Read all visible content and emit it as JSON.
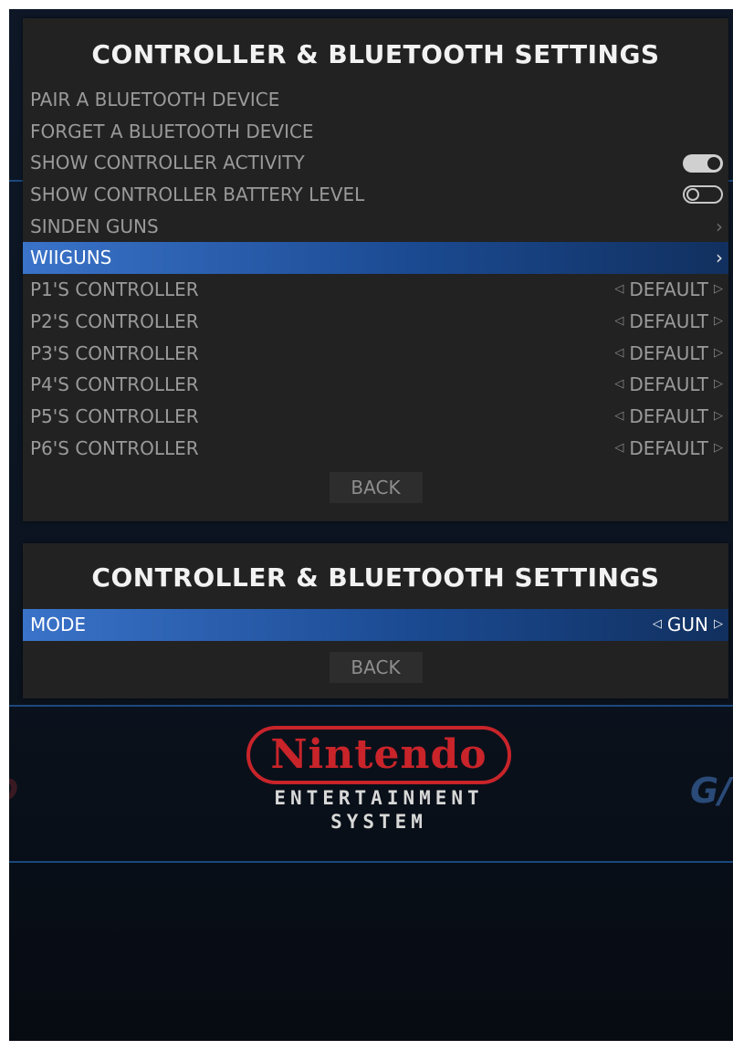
{
  "background": {
    "system_logo": {
      "brand": "Nintendo",
      "subtitle_line1": "ENTERTAINMENT",
      "subtitle_line2": "SYSTEM"
    },
    "left_partial_logo": "D",
    "right_partial_logo": "G/"
  },
  "colors": {
    "panel_bg": "#222222",
    "selected_start": "#3a73c9",
    "selected_end": "#11305f",
    "text_dim": "#9a9a9a",
    "nintendo_red": "#c8242a"
  },
  "main_menu": {
    "title": "CONTROLLER & BLUETOOTH SETTINGS",
    "items": [
      {
        "label": "PAIR A BLUETOOTH DEVICE",
        "control": "none"
      },
      {
        "label": "FORGET A BLUETOOTH DEVICE",
        "control": "none"
      },
      {
        "label": "SHOW CONTROLLER ACTIVITY",
        "control": "toggle",
        "state": "on"
      },
      {
        "label": "SHOW CONTROLLER BATTERY LEVEL",
        "control": "toggle",
        "state": "off"
      },
      {
        "label": "SINDEN GUNS",
        "control": "submenu",
        "icon": "chevron-right-icon"
      },
      {
        "label": "WIIGUNS",
        "control": "submenu",
        "icon": "chevron-right-icon",
        "selected": true
      },
      {
        "label": "P1'S CONTROLLER",
        "control": "option",
        "value": "DEFAULT"
      },
      {
        "label": "P2'S CONTROLLER",
        "control": "option",
        "value": "DEFAULT"
      },
      {
        "label": "P3'S CONTROLLER",
        "control": "option",
        "value": "DEFAULT"
      },
      {
        "label": "P4'S CONTROLLER",
        "control": "option",
        "value": "DEFAULT"
      },
      {
        "label": "P5'S CONTROLLER",
        "control": "option",
        "value": "DEFAULT"
      },
      {
        "label": "P6'S CONTROLLER",
        "control": "option",
        "value": "DEFAULT"
      }
    ],
    "back_label": "BACK"
  },
  "sub_menu": {
    "title": "CONTROLLER & BLUETOOTH SETTINGS",
    "items": [
      {
        "label": "MODE",
        "control": "option",
        "value": "GUN",
        "selected": true
      }
    ],
    "back_label": "BACK"
  }
}
